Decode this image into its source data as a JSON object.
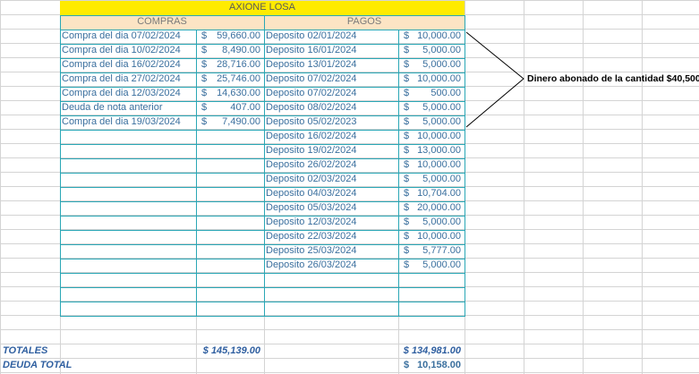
{
  "title": "AXIONE LOSA",
  "headers": {
    "compras": "COMPRAS",
    "pagos": "PAGOS"
  },
  "currency": "$",
  "compras": [
    {
      "desc": "Compra del dia 07/02/2024",
      "amount": "59,660.00"
    },
    {
      "desc": "Compra del dia 10/02/2024",
      "amount": "8,490.00"
    },
    {
      "desc": "Compra del dia 16/02/2024",
      "amount": "28,716.00"
    },
    {
      "desc": "Compra del dia 27/02/2024",
      "amount": "25,746.00"
    },
    {
      "desc": "Compra del dia 12/03/2024",
      "amount": "14,630.00"
    },
    {
      "desc": "Deuda de nota anterior",
      "amount": "407.00"
    },
    {
      "desc": "Compra del dia 19/03/2024",
      "amount": "7,490.00"
    }
  ],
  "pagos": [
    {
      "desc": "Deposito 02/01/2024",
      "amount": "10,000.00"
    },
    {
      "desc": "Deposito 16/01/2024",
      "amount": "5,000.00"
    },
    {
      "desc": "Deposito 13/01/2024",
      "amount": "5,000.00"
    },
    {
      "desc": "Deposito 07/02/2024",
      "amount": "10,000.00"
    },
    {
      "desc": "Deposito 07/02/2024",
      "amount": "500.00"
    },
    {
      "desc": "Deposito 08/02/2024",
      "amount": "5,000.00"
    },
    {
      "desc": "Deposito 05/02/2023",
      "amount": "5,000.00"
    },
    {
      "desc": "Deposito 16/02/2024",
      "amount": "10,000.00"
    },
    {
      "desc": "Deposito 19/02/2024",
      "amount": "13,000.00"
    },
    {
      "desc": "Deposito 26/02/2024",
      "amount": "10,000.00"
    },
    {
      "desc": "Deposito 02/03/2024",
      "amount": "5,000.00"
    },
    {
      "desc": "Deposito 04/03/2024",
      "amount": "10,704.00"
    },
    {
      "desc": "Deposito 05/03/2024",
      "amount": "20,000.00"
    },
    {
      "desc": "Deposito 12/03/2024",
      "amount": "5,000.00"
    },
    {
      "desc": "Deposito 22/03/2024",
      "amount": "10,000.00"
    },
    {
      "desc": "Deposito 25/03/2024",
      "amount": "5,777.00"
    },
    {
      "desc": "Deposito 26/03/2024",
      "amount": "5,000.00"
    }
  ],
  "totales": {
    "label": "TOTALES",
    "compras": "$ 145,139.00",
    "pagos": "$ 134,981.00"
  },
  "deuda": {
    "label": "DEUDA TOTAL",
    "currency": "$",
    "amount": "10,158.00"
  },
  "note": "Dinero abonado de la cantidad $40,500"
}
